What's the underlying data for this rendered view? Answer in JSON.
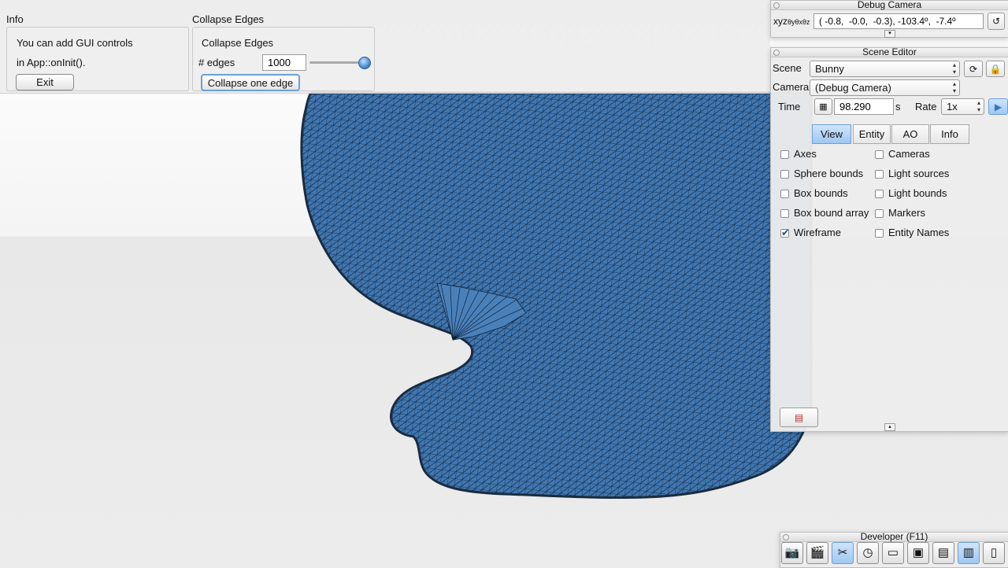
{
  "info_pane": {
    "title": "Info",
    "line1": "You can add GUI controls",
    "line2": "in App::onInit().",
    "exit_label": "Exit"
  },
  "collapse_pane": {
    "title": "Collapse Edges",
    "heading": "Collapse Edges",
    "edges_label": "# edges",
    "edges_value": "1000",
    "slider_fraction": 1.0,
    "collapse_button_label": "Collapse one edge"
  },
  "debug_camera": {
    "title": "Debug Camera",
    "xyz_label": "xyz",
    "angle_label": "θyθxθz",
    "value": "( -0.8,  -0.0,  -0.3), -103.4º,  -7.4º",
    "expand_arrow": "▾"
  },
  "scene_editor": {
    "title": "Scene Editor",
    "scene_label": "Scene",
    "scene_value": "Bunny",
    "camera_label": "Camera",
    "camera_value": "(Debug Camera)",
    "time_label": "Time",
    "time_value": "98.290",
    "time_unit": "s",
    "rate_label": "Rate",
    "rate_value": "1x",
    "tabs": [
      "View",
      "Entity",
      "AO",
      "Info"
    ],
    "active_tab": "View",
    "checkboxes_left": [
      {
        "label": "Axes",
        "checked": false
      },
      {
        "label": "Sphere bounds",
        "checked": false
      },
      {
        "label": "Box bounds",
        "checked": false
      },
      {
        "label": "Box bound array",
        "checked": false
      },
      {
        "label": "Wireframe",
        "checked": true
      }
    ],
    "checkboxes_right": [
      {
        "label": "Cameras",
        "checked": false
      },
      {
        "label": "Light sources",
        "checked": false
      },
      {
        "label": "Light bounds",
        "checked": false
      },
      {
        "label": "Markers",
        "checked": false
      },
      {
        "label": "Entity Names",
        "checked": false
      }
    ]
  },
  "developer": {
    "title": "Developer (F11)",
    "icons": [
      "camera-icon",
      "clapperboard-icon",
      "tools-icon",
      "speed-icon",
      "notepad-icon",
      "terminal-icon",
      "windows-icon",
      "monitor-icon",
      "document-icon"
    ]
  },
  "colors": {
    "mesh_fill": "#3f74ad",
    "mesh_wire": "#10243a",
    "accent": "#9fc7f2"
  }
}
